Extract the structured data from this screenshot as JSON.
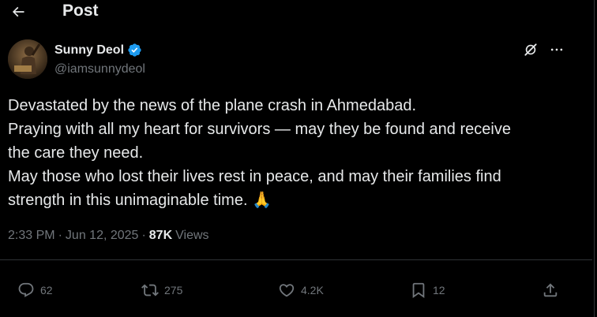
{
  "header": {
    "title": "Post",
    "back_icon": "arrow-left-icon"
  },
  "author": {
    "name": "Sunny Deol",
    "handle": "@iamsunnydeol",
    "verified": true,
    "verified_color": "#1d9bf0"
  },
  "tweet": {
    "lines": [
      "Devastated by the news of the plane crash in Ahmedabad.",
      "Praying with all my heart for survivors — may they be found and receive",
      "the care they need.",
      "May those who lost their lives rest in peace, and may their families find",
      "strength in this unimaginable time. 🙏"
    ]
  },
  "meta": {
    "time": "2:33 PM",
    "dot1": "·",
    "date": "Jun 12, 2025",
    "dot2": "·",
    "views_count": "87K",
    "views_label": "Views"
  },
  "actions": {
    "replies": "62",
    "reposts": "275",
    "likes": "4.2K",
    "bookmarks": "12"
  },
  "colors": {
    "background": "#000000",
    "text": "#e7e9ea",
    "secondary": "#71767b",
    "border": "#2f3336"
  }
}
